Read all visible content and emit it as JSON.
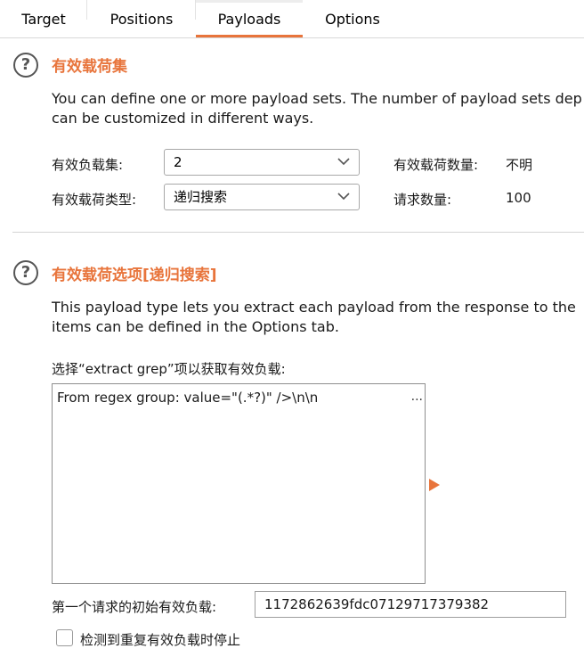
{
  "tabs": [
    "Target",
    "Positions",
    "Payloads",
    "Options"
  ],
  "payload_sets": {
    "help_icon": "help-icon",
    "title": "有效载荷集",
    "desc_line1": "You can define one or more payload sets. The number of payload sets dep",
    "desc_line2": "can be customized in different ways.",
    "set_label": "有效负载集:",
    "set_value": "2",
    "type_label": "有效载荷类型:",
    "type_value": "递归搜索",
    "count_label": "有效载荷数量:",
    "count_value": "不明",
    "requests_label": "请求数量:",
    "requests_value": "100"
  },
  "payload_options": {
    "title": "有效载荷选项[递归搜索]",
    "desc_line1": "This payload type lets you extract each payload from the response to the",
    "desc_line2": "items can be defined in the Options tab.",
    "select_label": "选择“extract grep”项以获取有效负载:",
    "list_items": [
      "From regex group:  value=\"(.*?)\" />\\n\\n"
    ],
    "list_ellipsis": "...",
    "initial_label": "第一个请求的初始有效负载:",
    "initial_value": "1172862639fdc07129717379382",
    "stop_label": "检测到重复有效负载时停止",
    "stop_checked": false
  },
  "colors": {
    "accent": "#e8743b"
  }
}
